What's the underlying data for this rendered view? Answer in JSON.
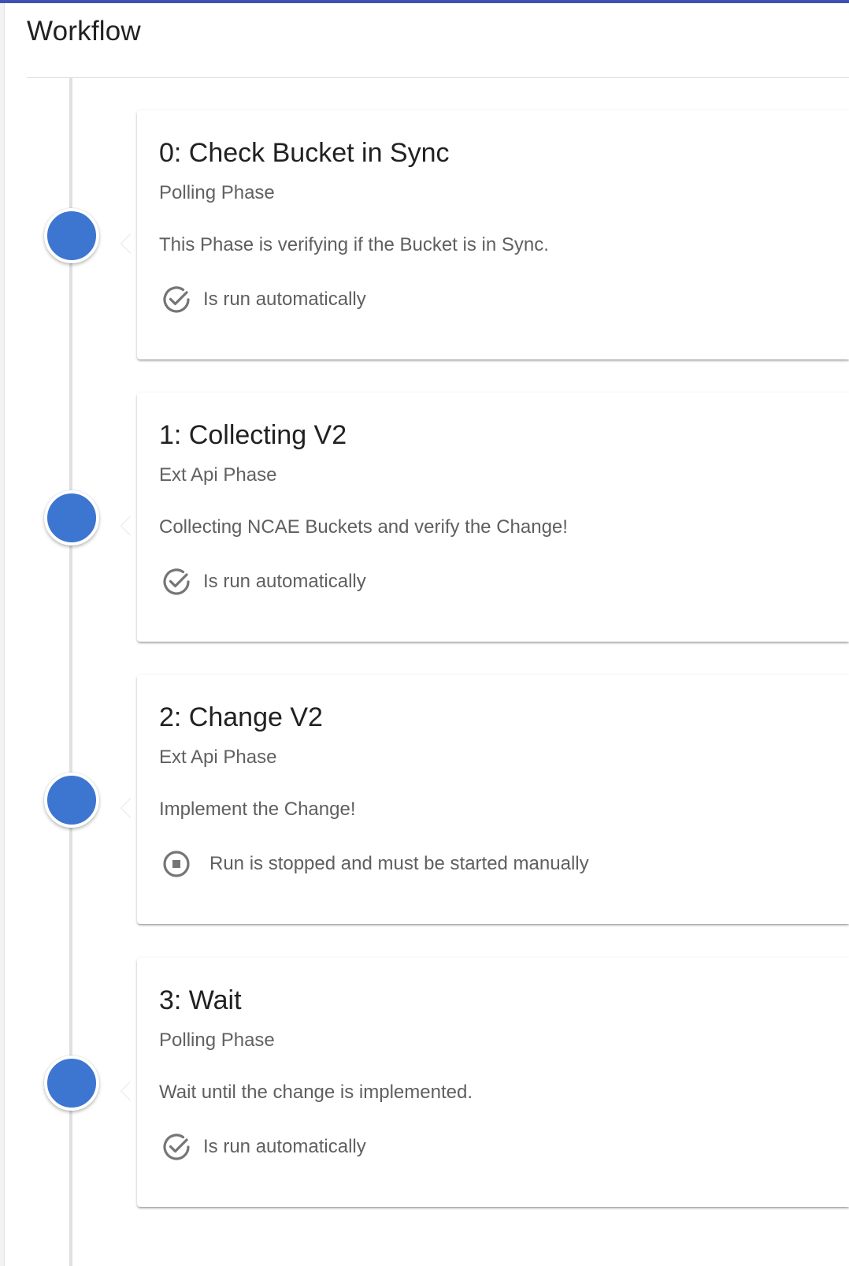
{
  "header": {
    "title": "Workflow"
  },
  "colors": {
    "accent": "#3f51b5",
    "dot": "#3c76d0",
    "icon": "#757575"
  },
  "phases": [
    {
      "title": "0: Check Bucket in Sync",
      "type": "Polling Phase",
      "description": "This Phase is verifying if the Bucket is in Sync.",
      "status_icon": "check-circle-icon",
      "status_text": "Is run automatically"
    },
    {
      "title": "1: Collecting V2",
      "type": "Ext Api Phase",
      "description": "Collecting NCAE Buckets and verify the Change!",
      "status_icon": "check-circle-icon",
      "status_text": "Is run automatically"
    },
    {
      "title": "2: Change V2",
      "type": "Ext Api Phase",
      "description": "Implement the Change!",
      "status_icon": "stop-circle-icon",
      "status_text": "Run is stopped and must be started manually"
    },
    {
      "title": "3: Wait",
      "type": "Polling Phase",
      "description": "Wait until the change is implemented.",
      "status_icon": "check-circle-icon",
      "status_text": "Is run automatically"
    }
  ]
}
